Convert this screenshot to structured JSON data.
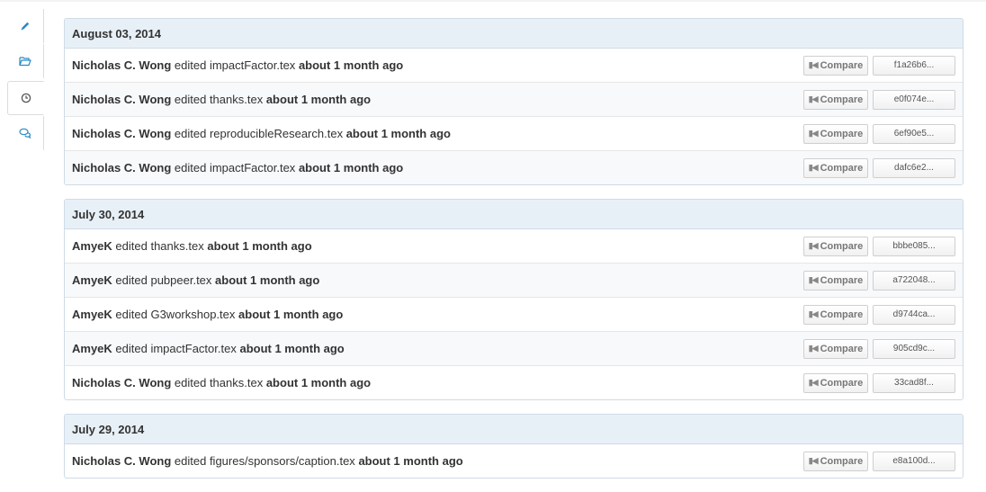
{
  "sidebar": {
    "tabs": [
      {
        "icon": "pencil-icon",
        "active": false
      },
      {
        "icon": "folder-open-icon",
        "active": false
      },
      {
        "icon": "clock-icon",
        "active": true
      },
      {
        "icon": "chat-icon",
        "active": false
      }
    ]
  },
  "accent_color": "#2a8ac6",
  "compare_label": "Compare",
  "verb": "edited",
  "groups": [
    {
      "date": "August 03, 2014",
      "entries": [
        {
          "user": "Nicholas C. Wong",
          "file": "impactFactor.tex",
          "when": "about 1 month ago",
          "sha": "f1a26b6..."
        },
        {
          "user": "Nicholas C. Wong",
          "file": "thanks.tex",
          "when": "about 1 month ago",
          "sha": "e0f074e..."
        },
        {
          "user": "Nicholas C. Wong",
          "file": "reproducibleResearch.tex",
          "when": "about 1 month ago",
          "sha": "6ef90e5..."
        },
        {
          "user": "Nicholas C. Wong",
          "file": "impactFactor.tex",
          "when": "about 1 month ago",
          "sha": "dafc6e2..."
        }
      ]
    },
    {
      "date": "July 30, 2014",
      "entries": [
        {
          "user": "AmyeK",
          "file": "thanks.tex",
          "when": "about 1 month ago",
          "sha": "bbbe085..."
        },
        {
          "user": "AmyeK",
          "file": "pubpeer.tex",
          "when": "about 1 month ago",
          "sha": "a722048..."
        },
        {
          "user": "AmyeK",
          "file": "G3workshop.tex",
          "when": "about 1 month ago",
          "sha": "d9744ca..."
        },
        {
          "user": "AmyeK",
          "file": "impactFactor.tex",
          "when": "about 1 month ago",
          "sha": "905cd9c..."
        },
        {
          "user": "Nicholas C. Wong",
          "file": "thanks.tex",
          "when": "about 1 month ago",
          "sha": "33cad8f..."
        }
      ]
    },
    {
      "date": "July 29, 2014",
      "entries": [
        {
          "user": "Nicholas C. Wong",
          "file": "figures/sponsors/caption.tex",
          "when": "about 1 month ago",
          "sha": "e8a100d..."
        }
      ]
    }
  ]
}
